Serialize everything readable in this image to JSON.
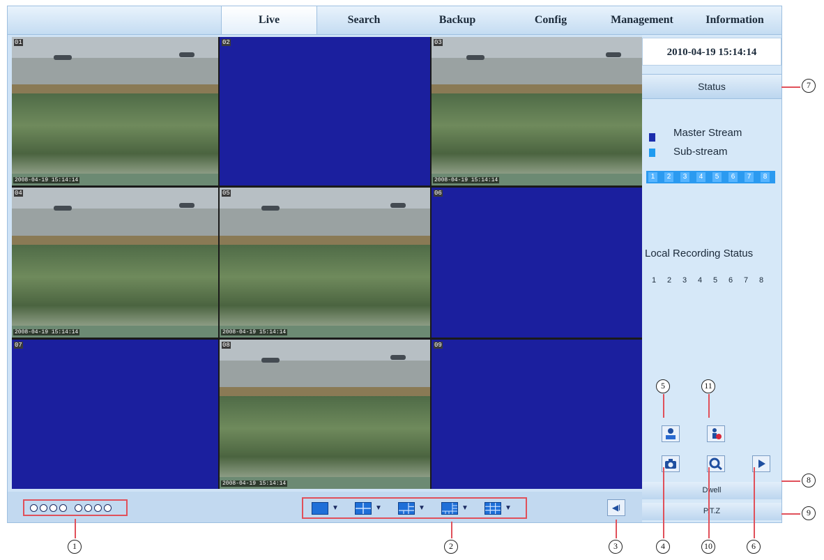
{
  "nav": {
    "tabs": [
      {
        "label": "Live",
        "active": true
      },
      {
        "label": "Search",
        "active": false
      },
      {
        "label": "Backup",
        "active": false
      },
      {
        "label": "Config",
        "active": false
      },
      {
        "label": "Management",
        "active": false
      },
      {
        "label": "Information",
        "active": false
      }
    ]
  },
  "video": {
    "cells": [
      {
        "channel": "01",
        "has_video": true,
        "timestamp": "2008-04-19 15:14:14"
      },
      {
        "channel": "02",
        "has_video": false
      },
      {
        "channel": "03",
        "has_video": true,
        "timestamp": "2008-04-19 15:14:14"
      },
      {
        "channel": "04",
        "has_video": true,
        "timestamp": "2008-04-19 15:14:14"
      },
      {
        "channel": "05",
        "has_video": true,
        "timestamp": "2008-04-19 15:14:14"
      },
      {
        "channel": "06",
        "has_video": false
      },
      {
        "channel": "07",
        "has_video": false
      },
      {
        "channel": "08",
        "has_video": true,
        "timestamp": "2008-04-19 15:14:14"
      },
      {
        "channel": "09",
        "has_video": false
      }
    ]
  },
  "right_panel": {
    "datetime": "2010-04-19 15:14:14",
    "status_label": "Status",
    "legend": {
      "master": "Master Stream",
      "sub": "Sub-stream",
      "master_color": "#1b2dad",
      "sub_color": "#1f9bf0"
    },
    "stream_channels": [
      "1",
      "2",
      "3",
      "4",
      "5",
      "6",
      "7",
      "8"
    ],
    "local_recording_title": "Local Recording Status",
    "local_recording_channels": [
      "1",
      "2",
      "3",
      "4",
      "5",
      "6",
      "7",
      "8"
    ],
    "dwell_label": "Dwell",
    "ptz_label": "P.T.Z"
  },
  "icons": {
    "record": "record-icon",
    "manual_alarm": "manual-alarm-icon",
    "snapshot": "camera-icon",
    "zoom": "zoom-icon",
    "play": "play-icon",
    "audio": "speaker-icon"
  },
  "callouts": [
    "1",
    "2",
    "3",
    "4",
    "5",
    "6",
    "7",
    "8",
    "9",
    "10",
    "11"
  ],
  "colors": {
    "accent_red": "#e0505a",
    "video_blue": "#1b1f9e"
  }
}
